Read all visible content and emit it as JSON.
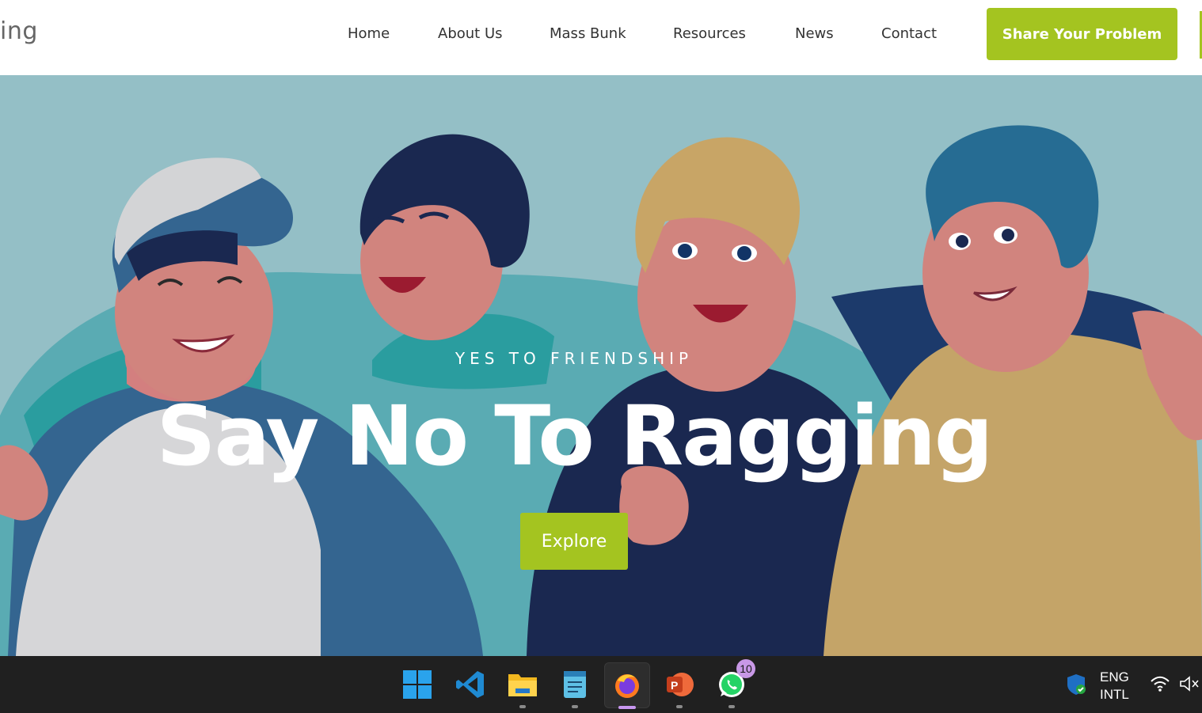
{
  "header": {
    "logo_text": "ing",
    "nav": [
      "Home",
      "About Us",
      "Mass Bunk",
      "Resources",
      "News",
      "Contact"
    ],
    "cta_label": "Share Your Problem"
  },
  "hero": {
    "subtitle": "YES TO FRIENDSHIP",
    "title": "Say No To Ragging",
    "button_label": "Explore"
  },
  "taskbar": {
    "apps": [
      {
        "name": "windows-start-icon"
      },
      {
        "name": "vscode-icon"
      },
      {
        "name": "file-explorer-icon"
      },
      {
        "name": "notepad-icon"
      },
      {
        "name": "firefox-icon"
      },
      {
        "name": "powerpoint-icon"
      },
      {
        "name": "whatsapp-icon"
      }
    ],
    "whatsapp_badge": "10",
    "lang_line1": "ENG",
    "lang_line2": "INTL"
  },
  "colors": {
    "accent": "#a4c420",
    "hero_bg": "#94bfc6",
    "taskbar_bg": "#202020"
  }
}
